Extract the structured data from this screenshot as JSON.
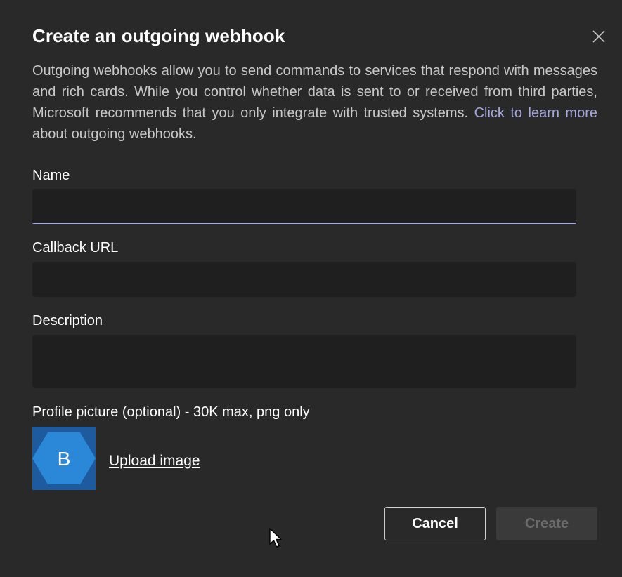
{
  "dialog": {
    "title": "Create an outgoing webhook",
    "close_icon": "close-icon",
    "description_text": "Outgoing webhooks allow you to send commands to services that respond with messages and rich cards. While you control whether data is sent to or received from third parties, Microsoft recommends that you only integrate with trusted systems. ",
    "learn_more_link": "Click to learn more",
    "description_suffix": " about outgoing webhooks."
  },
  "form": {
    "name_label": "Name",
    "name_value": "",
    "callback_label": "Callback URL",
    "callback_value": "",
    "description_label": "Description",
    "description_value": "",
    "profile_label": "Profile picture (optional) - 30K max, png only",
    "avatar_letter": "B",
    "upload_label": "Upload image"
  },
  "actions": {
    "cancel_label": "Cancel",
    "create_label": "Create"
  },
  "colors": {
    "background": "#292929",
    "input_background": "#1f1f1f",
    "accent": "#a6a7dc",
    "avatar_hex": "#2b88d8",
    "avatar_bg": "#1e5a9e"
  }
}
